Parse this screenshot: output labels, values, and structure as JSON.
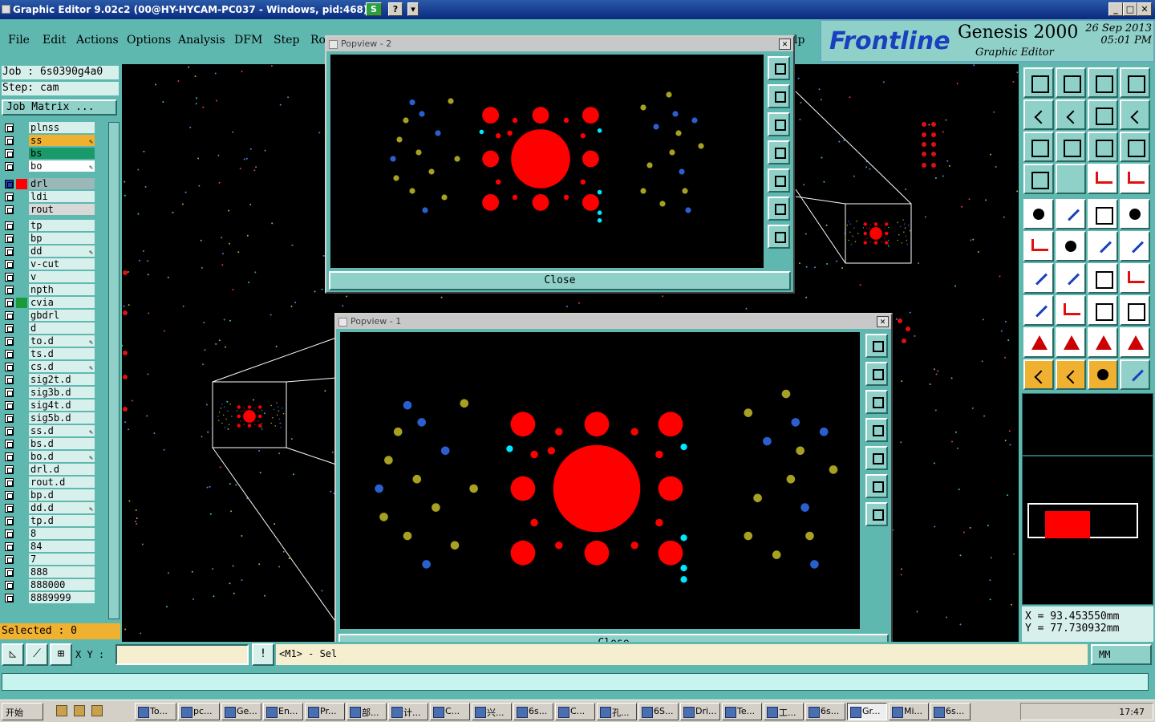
{
  "window": {
    "title": "Graphic Editor 9.02c2 (00@HY-HYCAM-PC037 - Windows, pid:468)",
    "btn_s": "S",
    "btn_help": "?",
    "btn_drop": "▾",
    "min": "_",
    "max": "□",
    "close": "✕"
  },
  "menu": [
    "File",
    "Edit",
    "Actions",
    "Options",
    "Analysis",
    "DFM",
    "Step",
    "Ro",
    "lp"
  ],
  "logo": {
    "brand": "Frontline",
    "product": "Genesis 2000",
    "sub": "Graphic Editor",
    "date": "26 Sep 2013",
    "time": "05:01 PM"
  },
  "job": {
    "job_line": "Job : 6s0390g4a0",
    "step_line": "Step: cam",
    "matrix": "Job Matrix ..."
  },
  "layers": [
    {
      "name": "plnss",
      "color": "#d8f0ec"
    },
    {
      "name": "ss",
      "color": "#f0b030",
      "edit": true
    },
    {
      "name": "bs",
      "color": "#1a9a6a"
    },
    {
      "name": "bo",
      "color": "#ffffff",
      "edit": true
    },
    {
      "name": "drl",
      "color": "#9ab8b8",
      "sel": true
    },
    {
      "name": "ldi",
      "color": "#d8f0ec"
    },
    {
      "name": "rout",
      "color": "#d8d8d8"
    },
    {
      "name": "tp",
      "color": "#d8f0ec"
    },
    {
      "name": "bp",
      "color": "#d8f0ec"
    },
    {
      "name": "dd",
      "color": "#d8f0ec",
      "edit": true
    },
    {
      "name": "v-cut",
      "color": "#d8f0ec"
    },
    {
      "name": "v",
      "color": "#d8f0ec"
    },
    {
      "name": "npth",
      "color": "#d8f0ec"
    },
    {
      "name": "cvia",
      "color": "#d8f0ec",
      "sw": "#1a9a3a"
    },
    {
      "name": "gbdrl",
      "color": "#d8f0ec"
    },
    {
      "name": "d",
      "color": "#d8f0ec"
    },
    {
      "name": "to.d",
      "color": "#d8f0ec",
      "edit": true
    },
    {
      "name": "ts.d",
      "color": "#d8f0ec"
    },
    {
      "name": "cs.d",
      "color": "#d8f0ec",
      "edit": true
    },
    {
      "name": "sig2t.d",
      "color": "#d8f0ec"
    },
    {
      "name": "sig3b.d",
      "color": "#d8f0ec"
    },
    {
      "name": "sig4t.d",
      "color": "#d8f0ec"
    },
    {
      "name": "sig5b.d",
      "color": "#d8f0ec"
    },
    {
      "name": "ss.d",
      "color": "#d8f0ec",
      "edit": true
    },
    {
      "name": "bs.d",
      "color": "#d8f0ec"
    },
    {
      "name": "bo.d",
      "color": "#d8f0ec",
      "edit": true
    },
    {
      "name": "drl.d",
      "color": "#d8f0ec"
    },
    {
      "name": "rout.d",
      "color": "#d8f0ec"
    },
    {
      "name": "bp.d",
      "color": "#d8f0ec"
    },
    {
      "name": "dd.d",
      "color": "#d8f0ec",
      "edit": true
    },
    {
      "name": "tp.d",
      "color": "#d8f0ec"
    },
    {
      "name": "8",
      "color": "#d8f0ec"
    },
    {
      "name": "84",
      "color": "#d8f0ec"
    },
    {
      "name": "7",
      "color": "#d8f0ec"
    },
    {
      "name": "888",
      "color": "#d8f0ec"
    },
    {
      "name": "888000",
      "color": "#d8f0ec"
    },
    {
      "name": "8889999",
      "color": "#d8f0ec"
    }
  ],
  "selected": "Selected : 0",
  "popup2": {
    "title": "Popview - 2",
    "close": "Close"
  },
  "popup1": {
    "title": "Popview - 1",
    "close": "Close"
  },
  "bottom": {
    "xy_label": "X Y :",
    "xy_value": "",
    "msg": "<M1> - Sel",
    "units": "MM"
  },
  "coords": {
    "x": "X = 93.453550mm",
    "y": "Y = 77.730932mm"
  },
  "colors": {
    "pad": "#ff0000",
    "via_blue": "#2a5fd0",
    "via_olive": "#a8a020",
    "cyan": "#00e8ff"
  },
  "taskbar": {
    "start": "开始",
    "items": [
      "To...",
      "pc...",
      "Ge...",
      "En...",
      "Pr...",
      "部...",
      "计...",
      "C...",
      "兴...",
      "6s...",
      "C...",
      "孔...",
      "6S...",
      "Dri...",
      "Te...",
      "工...",
      "6s...",
      "Gr...",
      "Mi...",
      "6s..."
    ],
    "clock": "17:47"
  }
}
